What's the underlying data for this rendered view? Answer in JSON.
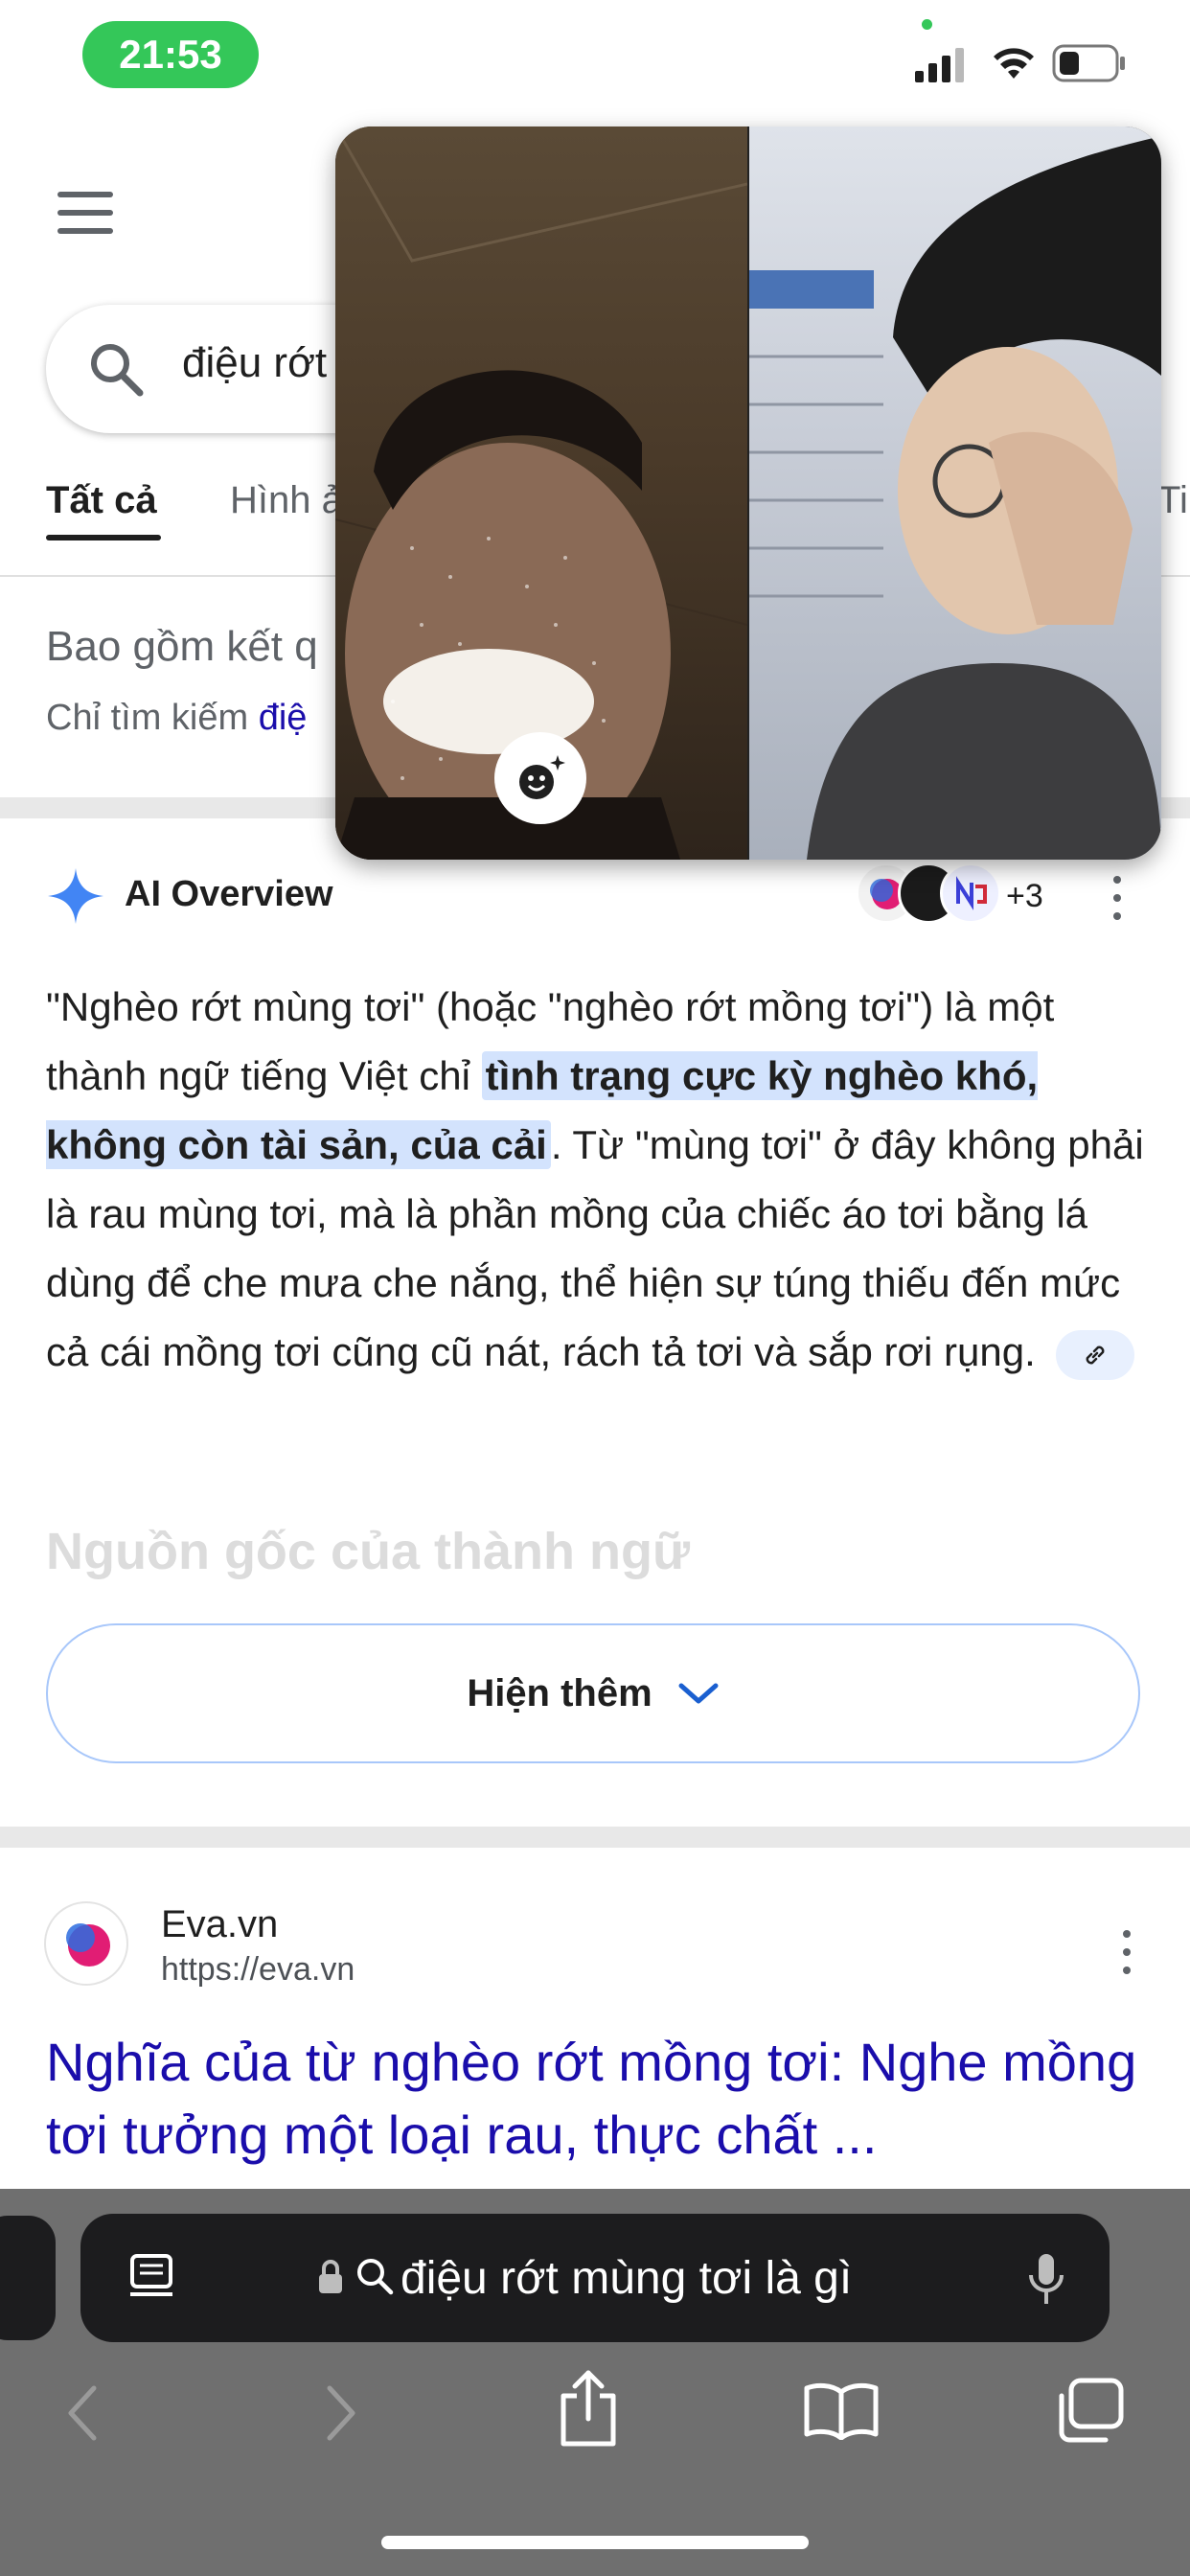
{
  "status_bar": {
    "time": "21:53",
    "icons": [
      "cellular-signal-icon",
      "wifi-icon",
      "battery-icon"
    ],
    "camera_indicator_color": "#34c759"
  },
  "header": {
    "menu_icon": "hamburger-menu-icon",
    "search": {
      "query_visible": "điệu rớt",
      "icon": "search-icon"
    },
    "tabs": [
      {
        "label": "Tất cả",
        "active": true
      },
      {
        "label": "Hình ả",
        "active": false
      },
      {
        "label": "Ti",
        "active": false
      }
    ]
  },
  "notice": {
    "include_text": "Bao gồm kết q",
    "only_search_prefix": "Chỉ tìm kiếm",
    "only_search_link": "điệ"
  },
  "ai_overview": {
    "title": "AI Overview",
    "sources_extra_count": "+3",
    "text_part1": "\"Nghèo rớt mùng tơi\" (hoặc \"nghèo rớt mồng tơi\") là một thành ngữ tiếng Việt chỉ ",
    "highlight": "tình trạng cực kỳ nghèo khó, không còn tài sản, của cải",
    "text_part2": ". Từ \"mùng tơi\" ở đây không phải là rau mùng tơi, mà là phần mồng của chiếc áo tơi bằng lá dùng để che mưa che nắng, thể hiện sự túng thiếu đến mức cả cái mồng tơi cũng cũ nát, rách tả tơi và sắp rơi rụng.",
    "faded_heading": "Nguồn gốc của thành ngữ",
    "show_more_label": "Hiện thêm"
  },
  "result": {
    "site_name": "Eva.vn",
    "url": "https://eva.vn",
    "title": "Nghĩa của từ nghèo rớt mồng tơi: Nghe mồng tơi tưởng một loại rau, thực chất ..."
  },
  "browser": {
    "address_text": "điệu rớt mùng tơi là gì",
    "toolbar_icons": [
      "back-icon",
      "forward-icon",
      "share-icon",
      "bookmarks-icon",
      "tabs-icon"
    ]
  },
  "colors": {
    "link_blue": "#1a0dab",
    "highlight_bg": "#d3e3fd",
    "time_pill_green": "#34c759",
    "ai_star_blue": "#4285f4"
  }
}
